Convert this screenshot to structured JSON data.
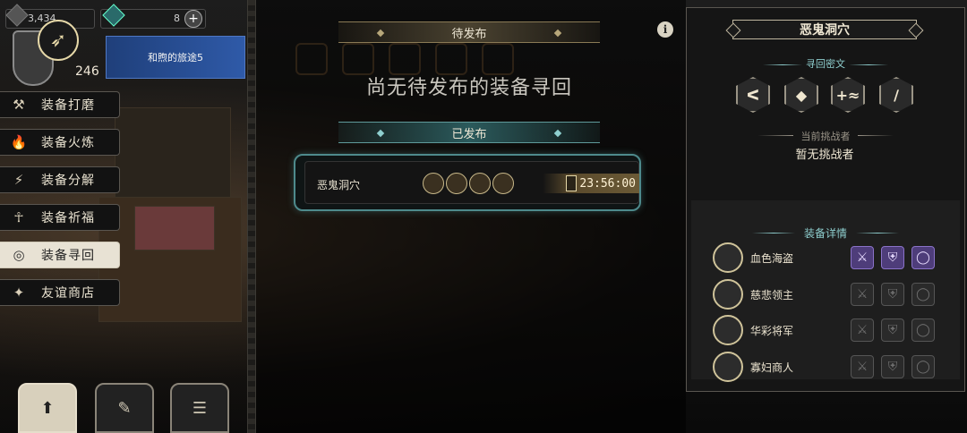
{
  "resources": {
    "gold": "3,434",
    "gems": "8",
    "add_label": "+"
  },
  "player": {
    "level": "246",
    "journey_title": "和煦的旅途5"
  },
  "menu": [
    {
      "icon": "hammer-icon",
      "glyph": "⚒",
      "label": "装备打磨"
    },
    {
      "icon": "fire-icon",
      "glyph": "🔥",
      "label": "装备火炼"
    },
    {
      "icon": "split-icon",
      "glyph": "⚡",
      "label": "装备分解"
    },
    {
      "icon": "pray-icon",
      "glyph": "☥",
      "label": "装备祈福"
    },
    {
      "icon": "target-icon",
      "glyph": "◎",
      "label": "装备寻回"
    },
    {
      "icon": "fox-icon",
      "glyph": "✦",
      "label": "友谊商店"
    }
  ],
  "active_menu_index": 4,
  "bottom_buttons": [
    "upload-icon",
    "feather-icon",
    "list-icon"
  ],
  "main": {
    "pending_tab": "待发布",
    "empty_text": "尚无待发布的装备寻回",
    "published_tab": "已发布",
    "published_item": {
      "name": "恶鬼洞穴",
      "timer": "23:56:00"
    }
  },
  "info_label": "i",
  "right": {
    "title": "恶鬼洞穴",
    "secret_label": "寻回密文",
    "secret_glyphs": [
      "ᐸ",
      "◆",
      "+≈",
      "∕"
    ],
    "challenger_label": "当前挑战者",
    "challenger_value": "暂无挑战者",
    "detail_label": "装备详情",
    "equipment": [
      {
        "name": "血色海盗",
        "unlocked": true
      },
      {
        "name": "慈悲领主",
        "unlocked": false
      },
      {
        "name": "华彩将军",
        "unlocked": false
      },
      {
        "name": "寡妇商人",
        "unlocked": false
      }
    ]
  },
  "colors": {
    "accent_teal": "#8fcfcf",
    "accent_gold": "#e6d8a8",
    "journey_blue": "#2f5aa8",
    "slot_purple": "#4e3d7a"
  }
}
